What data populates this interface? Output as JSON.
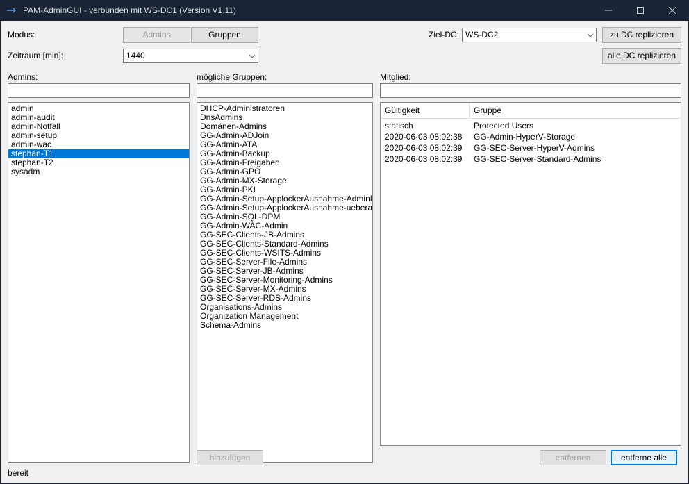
{
  "window": {
    "title": "PAM-AdminGUI - verbunden mit WS-DC1 (Version V1.11)"
  },
  "labels": {
    "modus": "Modus:",
    "zeitraum": "Zeitraum [min]:",
    "ziel_dc": "Ziel-DC:",
    "admins_header": "Admins:",
    "groups_header": "mögliche Gruppen:",
    "member_header": "Mitglied:"
  },
  "buttons": {
    "admins_tab": "Admins",
    "gruppen_tab": "Gruppen",
    "zu_dc": "zu DC replizieren",
    "alle_dc": "alle DC replizieren",
    "hinzufuegen": "hinzufügen",
    "entfernen": "entfernen",
    "entferne_alle": "entferne alle"
  },
  "combos": {
    "zeitraum_value": "1440",
    "ziel_dc_value": "WS-DC2"
  },
  "admins": {
    "items": [
      "admin",
      "admin-audit",
      "admin-Notfall",
      "admin-setup",
      "admin-wac",
      "stephan-T1",
      "stephan-T2",
      "sysadm"
    ],
    "selected_index": 5
  },
  "groups": {
    "items": [
      "DHCP-Administratoren",
      "DnsAdmins",
      "Domänen-Admins",
      "GG-Admin-ADJoin",
      "GG-Admin-ATA",
      "GG-Admin-Backup",
      "GG-Admin-Freigaben",
      "GG-Admin-GPO",
      "GG-Admin-MX-Storage",
      "GG-Admin-PKI",
      "GG-Admin-Setup-ApplockerAusnahme-AdminDir",
      "GG-Admin-Setup-ApplockerAusnahme-ueberall",
      "GG-Admin-SQL-DPM",
      "GG-Admin-WAC-Admin",
      "GG-SEC-Clients-JB-Admins",
      "GG-SEC-Clients-Standard-Admins",
      "GG-SEC-Clients-WSITS-Admins",
      "GG-SEC-Server-File-Admins",
      "GG-SEC-Server-JB-Admins",
      "GG-SEC-Server-Monitoring-Admins",
      "GG-SEC-Server-MX-Admins",
      "GG-SEC-Server-RDS-Admins",
      "Organisations-Admins",
      "Organization Management",
      "Schema-Admins"
    ]
  },
  "member": {
    "columns": {
      "gueltigkeit": "Gültigkeit",
      "gruppe": "Gruppe"
    },
    "rows": [
      {
        "g": "statisch",
        "r": "Protected Users"
      },
      {
        "g": "2020-06-03 08:02:38",
        "r": "GG-Admin-HyperV-Storage"
      },
      {
        "g": "2020-06-03 08:02:39",
        "r": "GG-SEC-Server-HyperV-Admins"
      },
      {
        "g": "2020-06-03 08:02:39",
        "r": "GG-SEC-Server-Standard-Admins"
      }
    ]
  },
  "status": "bereit"
}
